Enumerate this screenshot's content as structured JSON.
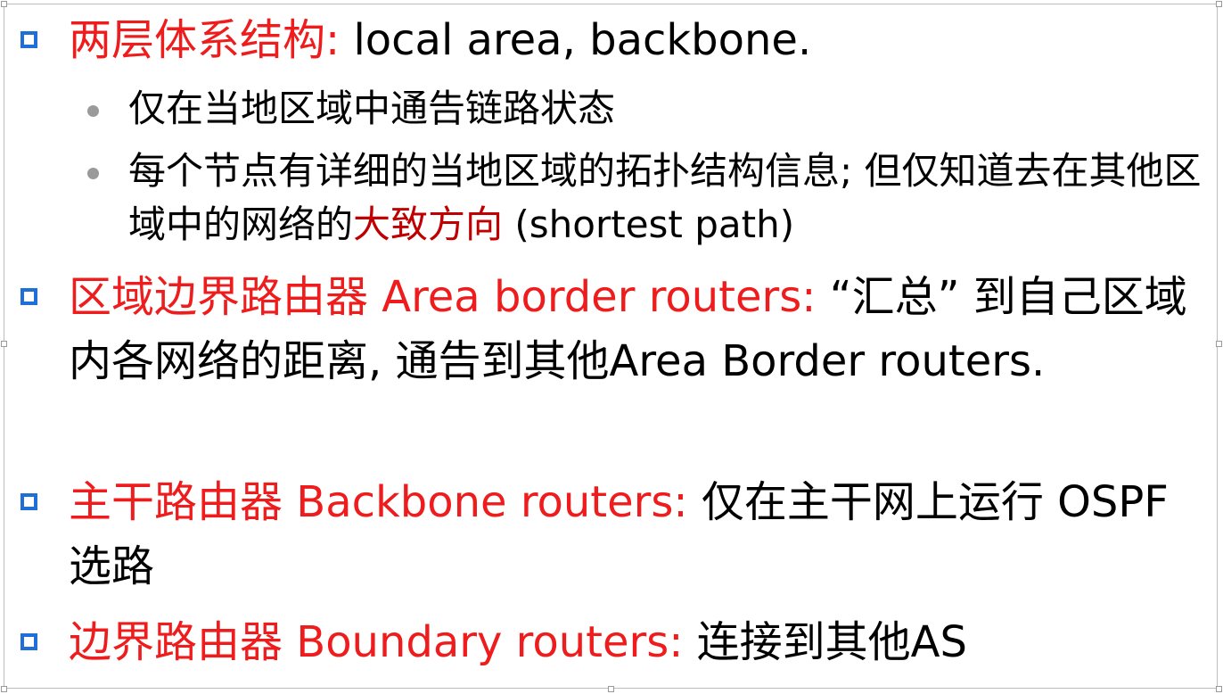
{
  "slide": {
    "bullets": [
      {
        "red": "两层体系结构:",
        "black": " local area, backbone.",
        "subs": [
          {
            "text": "仅在当地区域中通告链路状态"
          },
          {
            "pre": "每个节点有详细的当地区域的拓扑结构信息; 但仅知道去在其他区域中的网络的",
            "highlight": "大致方向",
            "post": " (shortest path)"
          }
        ]
      },
      {
        "red": "区域边界路由器 Area border routers:",
        "black": " “汇总” 到自己区域内各网络的距离, 通告到其他Area Border routers."
      },
      {
        "red": "主干路由器 Backbone routers:",
        "black": " 仅在主干网上运行 OSPF 选路"
      },
      {
        "red": "边界路由器 Boundary routers:",
        "black": " 连接到其他AS"
      }
    ]
  },
  "colors": {
    "title_red": "#ee1c1c",
    "highlight_red": "#c00000",
    "bullet_blue": "#1f6fd6",
    "sub_bullet_gray": "#9a9a9a"
  }
}
